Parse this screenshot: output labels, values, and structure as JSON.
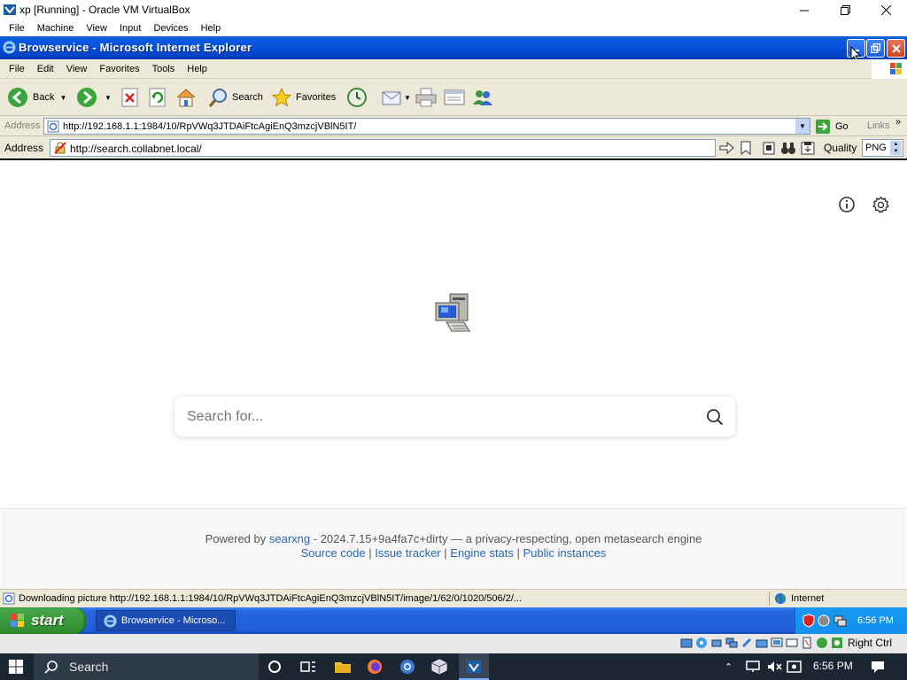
{
  "vbox": {
    "title": "xp [Running] - Oracle VM VirtualBox",
    "menu": [
      "File",
      "Machine",
      "View",
      "Input",
      "Devices",
      "Help"
    ],
    "host_key": "Right Ctrl"
  },
  "ie": {
    "title": "Browservice - Microsoft Internet Explorer",
    "menu": [
      "File",
      "Edit",
      "View",
      "Favorites",
      "Tools",
      "Help"
    ],
    "toolbar": {
      "back": "Back",
      "search": "Search",
      "favorites": "Favorites"
    },
    "address": {
      "label": "Address",
      "url": "http://192.168.1.1:1984/10/RpVWq3JTDAiFtcAgiEnQ3mzcjVBlN5IT/",
      "go": "Go",
      "links": "Links"
    },
    "status": {
      "text": "Downloading picture http://192.168.1.1:1984/10/RpVWq3JTDAiFtcAgiEnQ3mzcjVBlN5IT/image/1/62/0/1020/506/2/...",
      "zone": "Internet"
    }
  },
  "browservice": {
    "address_label": "Address",
    "url": "http://search.collabnet.local/",
    "quality_label": "Quality",
    "quality_value": "PNG"
  },
  "page": {
    "search_placeholder": "Search for...",
    "footer": {
      "powered_by": "Powered by",
      "engine": "searxng",
      "version_text": "- 2024.7.15+9a4fa7c+dirty — a privacy-respecting, open metasearch engine",
      "links": [
        "Source code",
        "Issue tracker",
        "Engine stats",
        "Public instances"
      ],
      "separator": "|"
    }
  },
  "xp_taskbar": {
    "start": "start",
    "task": "Browservice - Microso...",
    "clock": "6:56 PM"
  },
  "win_taskbar": {
    "search": "Search",
    "clock": "6:56 PM"
  }
}
